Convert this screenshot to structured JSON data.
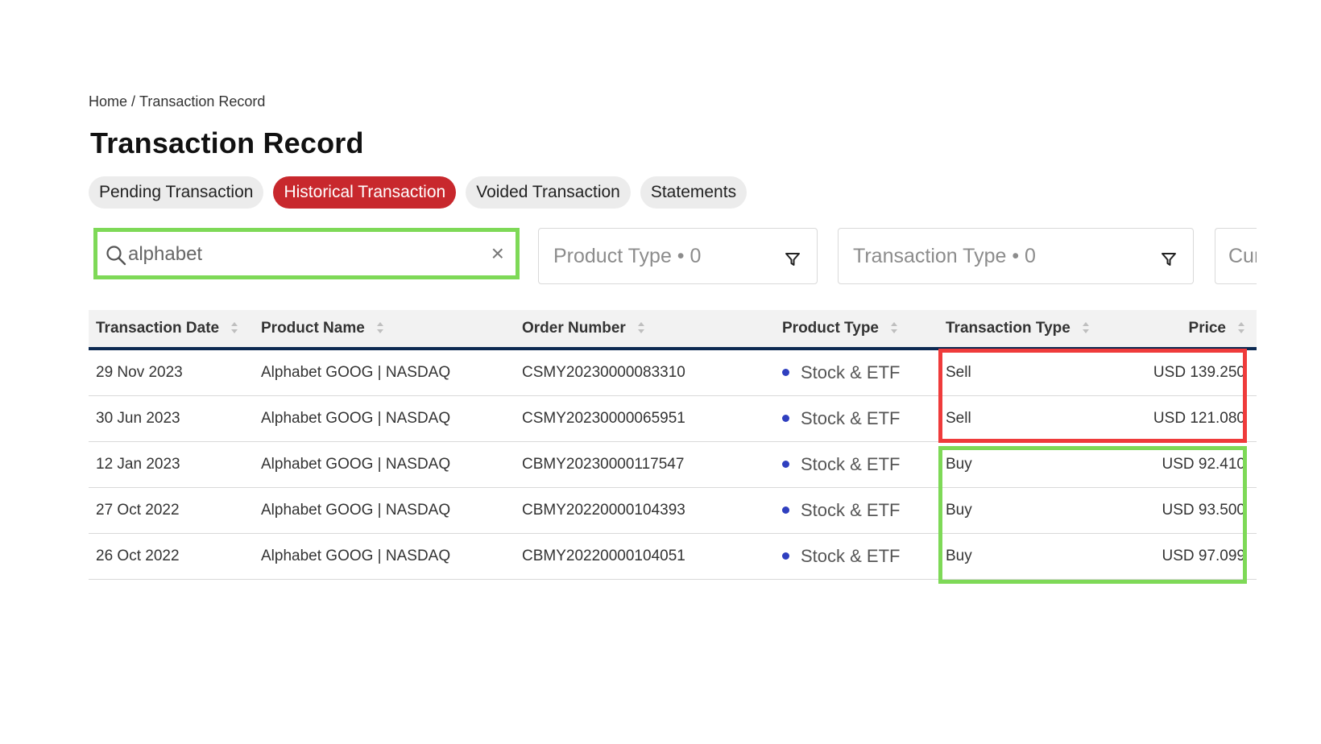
{
  "breadcrumb": {
    "home": "Home",
    "separator": " / ",
    "current": "Transaction Record"
  },
  "page_title": "Transaction Record",
  "tabs": [
    {
      "label": "Pending Transaction",
      "active": false
    },
    {
      "label": "Historical Transaction",
      "active": true
    },
    {
      "label": "Voided Transaction",
      "active": false
    },
    {
      "label": "Statements",
      "active": false
    }
  ],
  "search": {
    "value": "alphabet",
    "icon": "search-icon",
    "clear_icon": "close-icon",
    "clear_glyph": "×"
  },
  "filters": {
    "product_type": "Product Type • 0",
    "transaction_type": "Transaction Type • 0",
    "currency": "Cur"
  },
  "table": {
    "columns": {
      "date": "Transaction Date",
      "product_name": "Product Name",
      "order_number": "Order Number",
      "product_type": "Product Type",
      "transaction_type": "Transaction Type",
      "price": "Price"
    },
    "rows": [
      {
        "date": "29 Nov 2023",
        "product_name": "Alphabet GOOG | NASDAQ",
        "order_number": "CSMY20230000083310",
        "product_type": "Stock & ETF",
        "transaction_type": "Sell",
        "price": "USD 139.250"
      },
      {
        "date": "30 Jun 2023",
        "product_name": "Alphabet GOOG | NASDAQ",
        "order_number": "CSMY20230000065951",
        "product_type": "Stock & ETF",
        "transaction_type": "Sell",
        "price": "USD 121.080"
      },
      {
        "date": "12 Jan 2023",
        "product_name": "Alphabet GOOG | NASDAQ",
        "order_number": "CBMY20230000117547",
        "product_type": "Stock & ETF",
        "transaction_type": "Buy",
        "price": "USD 92.410"
      },
      {
        "date": "27 Oct 2022",
        "product_name": "Alphabet GOOG | NASDAQ",
        "order_number": "CBMY20220000104393",
        "product_type": "Stock & ETF",
        "transaction_type": "Buy",
        "price": "USD 93.500"
      },
      {
        "date": "26 Oct 2022",
        "product_name": "Alphabet GOOG | NASDAQ",
        "order_number": "CBMY20220000104051",
        "product_type": "Stock & ETF",
        "transaction_type": "Buy",
        "price": "USD 97.099"
      }
    ]
  },
  "colors": {
    "active_tab": "#c8282d",
    "header_underline": "#0d2a52",
    "highlight_sell": "#ef3b3b",
    "highlight_buy": "#7ed957",
    "product_dot": "#2f3fbf"
  }
}
